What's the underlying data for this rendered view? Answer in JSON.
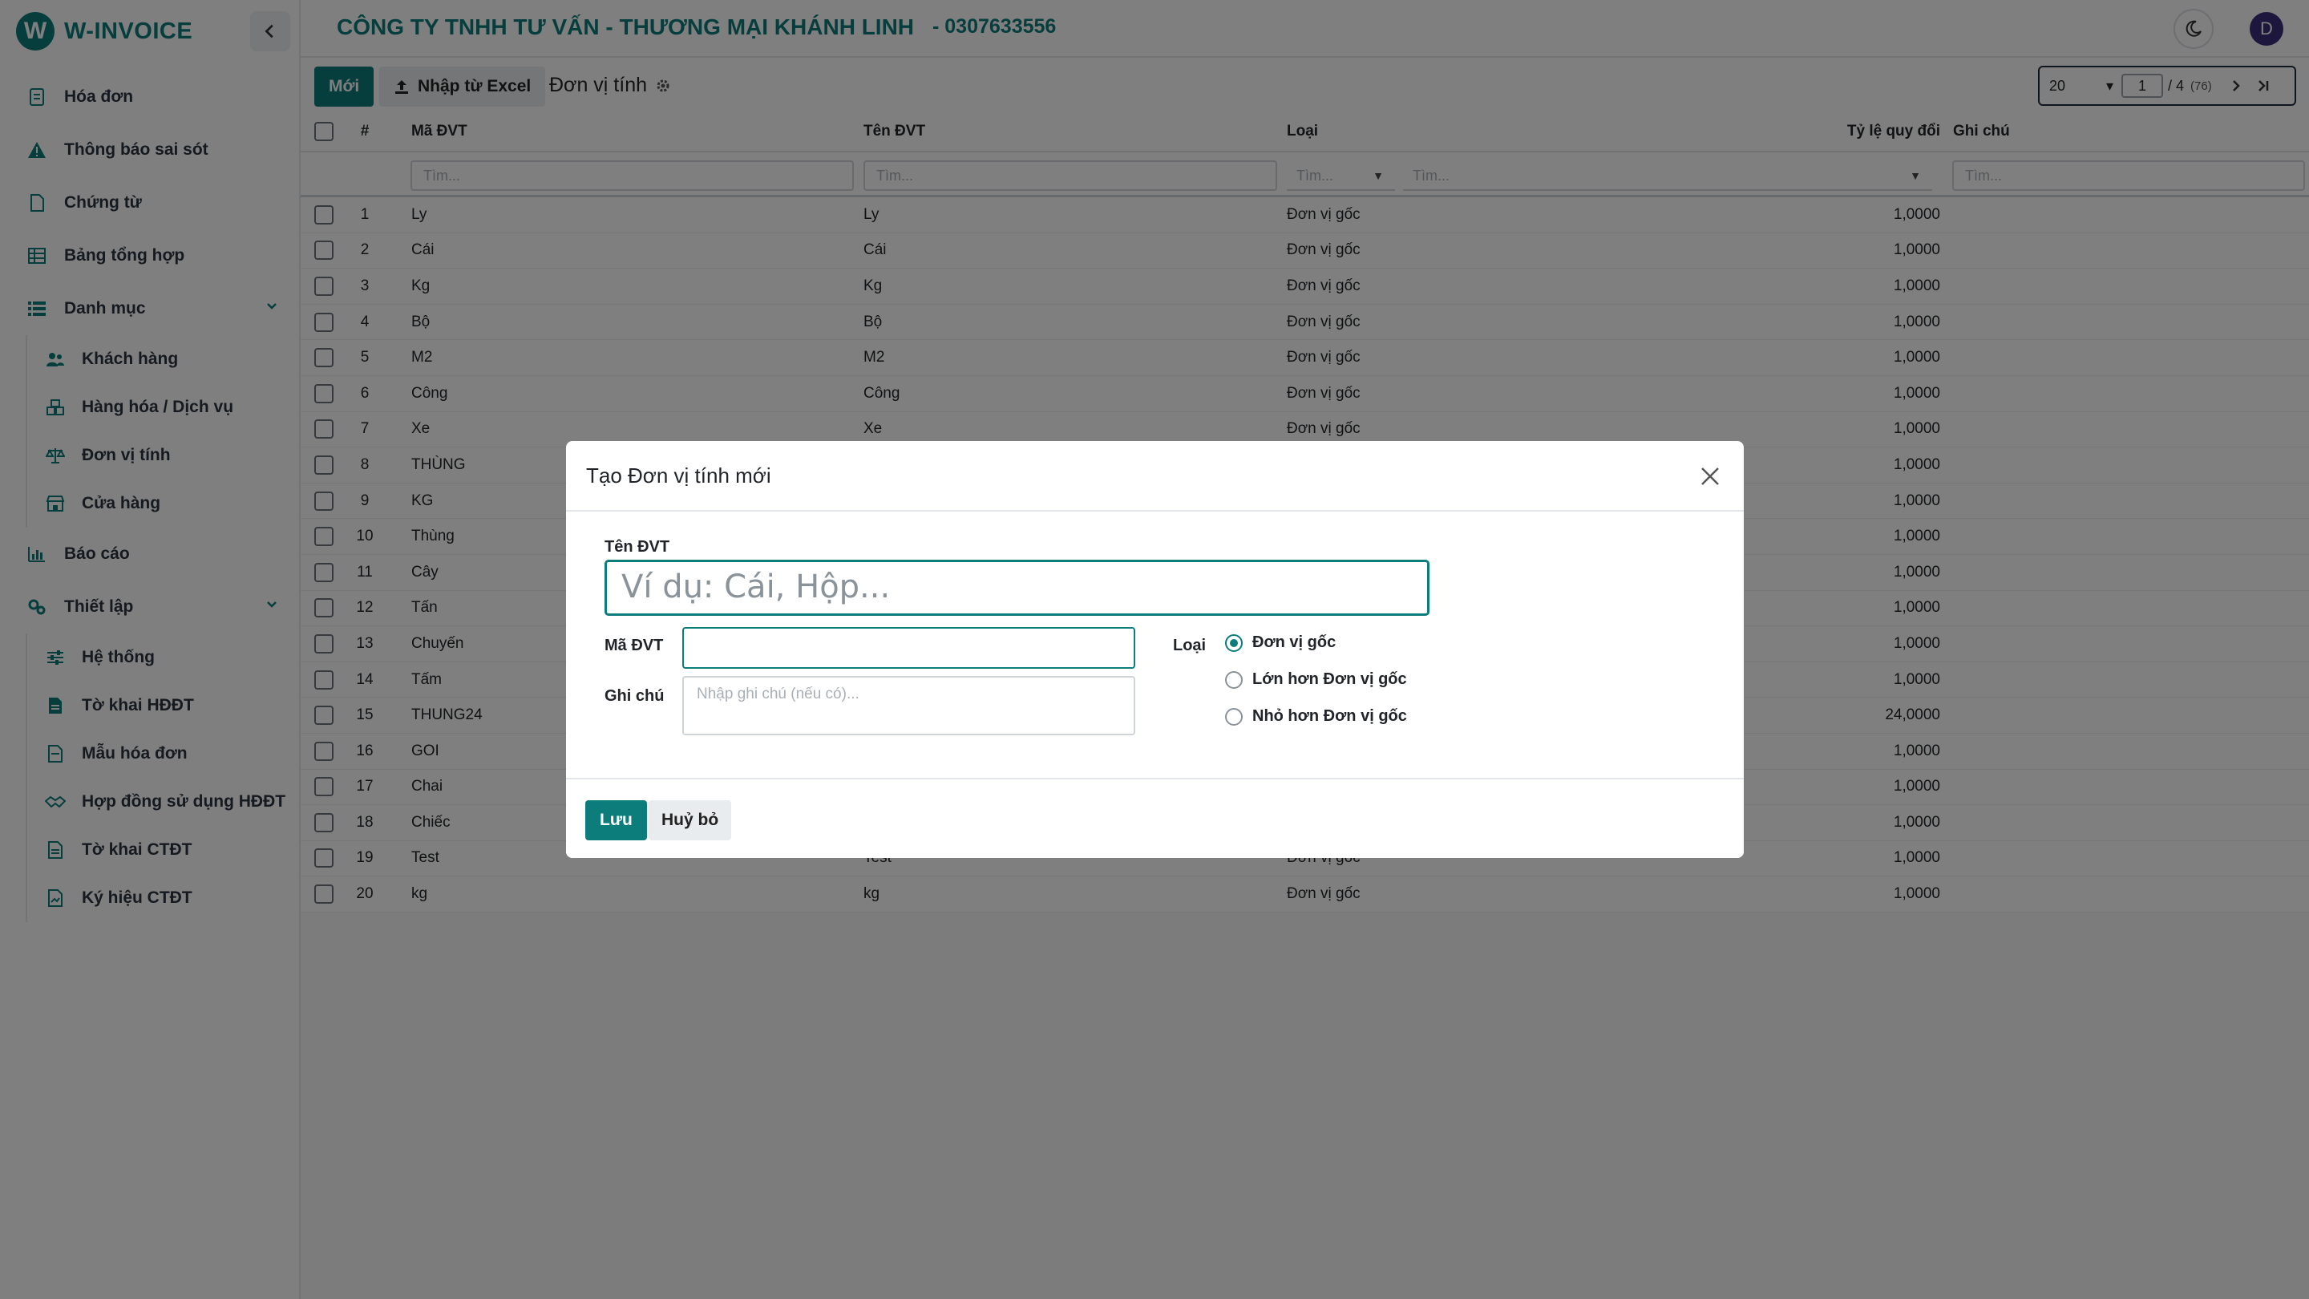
{
  "brand": {
    "name": "W-INVOICE",
    "logo_letter": "W"
  },
  "header": {
    "company": "CÔNG TY TNHH TƯ VẤN - THƯƠNG MẠI KHÁNH LINH",
    "tax_code": "- 0307633556",
    "avatar_letter": "D"
  },
  "sidebar": {
    "items": [
      {
        "label": "Hóa đơn",
        "icon": "invoice-icon"
      },
      {
        "label": "Thông báo sai sót",
        "icon": "warning-icon"
      },
      {
        "label": "Chứng từ",
        "icon": "document-icon"
      },
      {
        "label": "Bảng tổng hợp",
        "icon": "table-icon"
      },
      {
        "label": "Danh mục",
        "icon": "list-icon"
      }
    ],
    "danh_muc_children": [
      {
        "label": "Khách hàng",
        "icon": "users-icon"
      },
      {
        "label": "Hàng hóa / Dịch vụ",
        "icon": "boxes-icon"
      },
      {
        "label": "Đơn vị tính",
        "icon": "scale-icon"
      },
      {
        "label": "Cửa hàng",
        "icon": "store-icon"
      }
    ],
    "bao_cao": {
      "label": "Báo cáo",
      "icon": "chart-icon"
    },
    "thiet_lap": {
      "label": "Thiết lập",
      "icon": "settings-icon"
    },
    "thiet_lap_children": [
      {
        "label": "Hệ thống",
        "icon": "sliders-icon"
      },
      {
        "label": "Tờ khai HĐĐT",
        "icon": "file-icon"
      },
      {
        "label": "Mẫu hóa đơn",
        "icon": "template-icon"
      },
      {
        "label": "Hợp đồng sử dụng HĐĐT",
        "icon": "handshake-icon"
      },
      {
        "label": "Tờ khai CTĐT",
        "icon": "file-doc-icon"
      },
      {
        "label": "Ký hiệu CTĐT",
        "icon": "file-sign-icon"
      }
    ]
  },
  "toolbar": {
    "new_label": "Mới",
    "import_label": "Nhập từ Excel",
    "page_title": "Đơn vị tính",
    "page_size": "20",
    "page_current": "1",
    "page_of": "/ 4",
    "page_total": "(76)"
  },
  "table": {
    "headers": {
      "num": "#",
      "code": "Mã ĐVT",
      "name": "Tên ĐVT",
      "type": "Loại",
      "ratio": "Tỷ lệ quy đổi",
      "note": "Ghi chú"
    },
    "filter_placeholder": "Tìm...",
    "rows": [
      {
        "num": "1",
        "code": "Ly",
        "name": "Ly",
        "type": "Đơn vị gốc",
        "ratio": "1,0000"
      },
      {
        "num": "2",
        "code": "Cái",
        "name": "Cái",
        "type": "Đơn vị gốc",
        "ratio": "1,0000"
      },
      {
        "num": "3",
        "code": "Kg",
        "name": "Kg",
        "type": "Đơn vị gốc",
        "ratio": "1,0000"
      },
      {
        "num": "4",
        "code": "Bộ",
        "name": "Bộ",
        "type": "Đơn vị gốc",
        "ratio": "1,0000"
      },
      {
        "num": "5",
        "code": "M2",
        "name": "M2",
        "type": "Đơn vị gốc",
        "ratio": "1,0000"
      },
      {
        "num": "6",
        "code": "Công",
        "name": "Công",
        "type": "Đơn vị gốc",
        "ratio": "1,0000"
      },
      {
        "num": "7",
        "code": "Xe",
        "name": "Xe",
        "type": "Đơn vị gốc",
        "ratio": "1,0000"
      },
      {
        "num": "8",
        "code": "THÙNG",
        "name": "",
        "type": "",
        "ratio": "1,0000"
      },
      {
        "num": "9",
        "code": "KG",
        "name": "",
        "type": "",
        "ratio": "1,0000"
      },
      {
        "num": "10",
        "code": "Thùng",
        "name": "",
        "type": "",
        "ratio": "1,0000"
      },
      {
        "num": "11",
        "code": "Cây",
        "name": "",
        "type": "",
        "ratio": "1,0000"
      },
      {
        "num": "12",
        "code": "Tấn",
        "name": "",
        "type": "",
        "ratio": "1,0000"
      },
      {
        "num": "13",
        "code": "Chuyến",
        "name": "",
        "type": "",
        "ratio": "1,0000"
      },
      {
        "num": "14",
        "code": "Tấm",
        "name": "",
        "type": "",
        "ratio": "1,0000"
      },
      {
        "num": "15",
        "code": "THUNG24",
        "name": "",
        "type": "",
        "ratio": "24,0000"
      },
      {
        "num": "16",
        "code": "GOI",
        "name": "",
        "type": "",
        "ratio": "1,0000"
      },
      {
        "num": "17",
        "code": "Chai",
        "name": "",
        "type": "",
        "ratio": "1,0000"
      },
      {
        "num": "18",
        "code": "Chiếc",
        "name": "",
        "type": "",
        "ratio": "1,0000"
      },
      {
        "num": "19",
        "code": "Test",
        "name": "Test",
        "type": "Đơn vị gốc",
        "ratio": "1,0000"
      },
      {
        "num": "20",
        "code": "kg",
        "name": "kg",
        "type": "Đơn vị gốc",
        "ratio": "1,0000"
      }
    ]
  },
  "modal": {
    "title": "Tạo Đơn vị tính mới",
    "name_label": "Tên ĐVT",
    "name_placeholder": "Ví dụ: Cái, Hộp...",
    "code_label": "Mã ĐVT",
    "code_value": "",
    "note_label": "Ghi chú",
    "note_placeholder": "Nhập ghi chú (nếu có)...",
    "type_label": "Loại",
    "type_options": [
      "Đơn vị gốc",
      "Lớn hơn Đơn vị gốc",
      "Nhỏ hơn Đơn vị gốc"
    ],
    "type_selected": "Đơn vị gốc",
    "save_label": "Lưu",
    "cancel_label": "Huỷ bỏ"
  },
  "colors": {
    "accent": "#0d7d7b",
    "overlay": "rgba(0,0,0,0.5)",
    "avatar": "#3b2d7a"
  }
}
